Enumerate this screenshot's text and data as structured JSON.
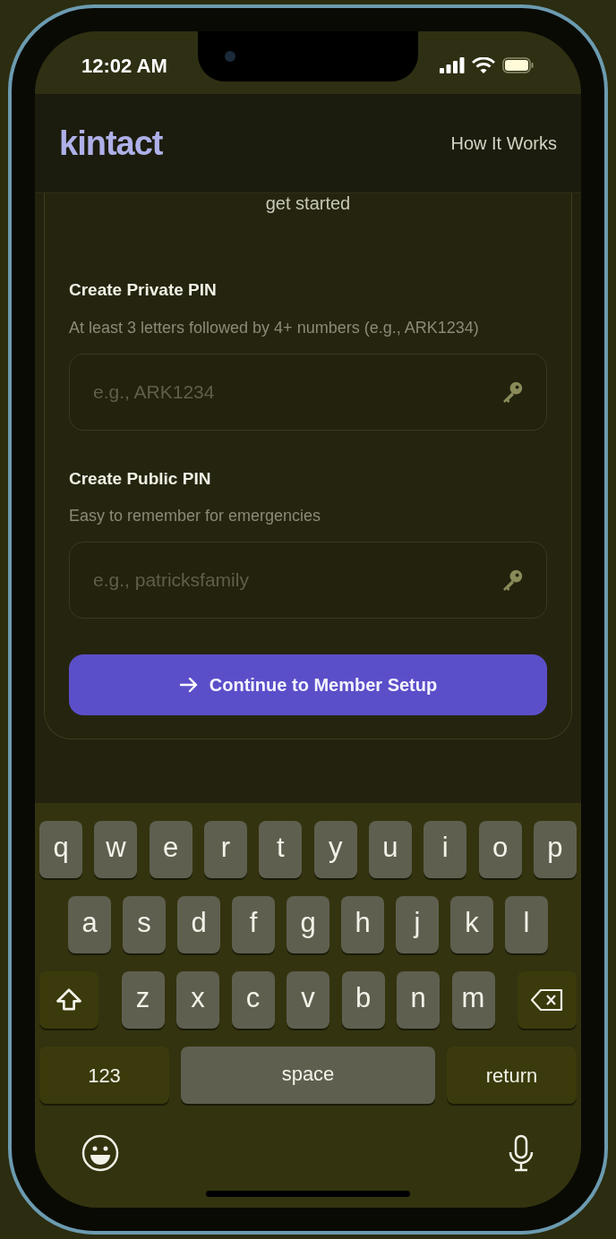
{
  "status_bar": {
    "time": "12:02 AM"
  },
  "header": {
    "logo": "kintact",
    "link": "How It Works"
  },
  "form": {
    "intro_text": "get started",
    "fields": [
      {
        "label": "Create Private PIN",
        "hint": "At least 3 letters followed by 4+ numbers (e.g., ARK1234)",
        "placeholder": "e.g., ARK1234"
      },
      {
        "label": "Create Public PIN",
        "hint": "Easy to remember for emergencies",
        "placeholder": "e.g., patricksfamily"
      }
    ],
    "button": "Continue to Member Setup"
  },
  "keyboard": {
    "rows": [
      {
        "keys": [
          {
            "kind": "letter",
            "text": "q"
          },
          {
            "kind": "letter",
            "text": "w"
          },
          {
            "kind": "letter",
            "text": "e"
          },
          {
            "kind": "letter",
            "text": "r"
          },
          {
            "kind": "letter",
            "text": "t"
          },
          {
            "kind": "letter",
            "text": "y"
          },
          {
            "kind": "letter",
            "text": "u"
          },
          {
            "kind": "letter",
            "text": "i"
          },
          {
            "kind": "letter",
            "text": "o"
          },
          {
            "kind": "letter",
            "text": "p"
          }
        ]
      },
      {
        "keys": [
          {
            "kind": "letter",
            "text": "a"
          },
          {
            "kind": "letter",
            "text": "s"
          },
          {
            "kind": "letter",
            "text": "d"
          },
          {
            "kind": "letter",
            "text": "f"
          },
          {
            "kind": "letter",
            "text": "g"
          },
          {
            "kind": "letter",
            "text": "h"
          },
          {
            "kind": "letter",
            "text": "j"
          },
          {
            "kind": "letter",
            "text": "k"
          },
          {
            "kind": "letter",
            "text": "l"
          }
        ]
      },
      {
        "keys": [
          {
            "kind": "shift"
          },
          {
            "kind": "letter",
            "text": "z"
          },
          {
            "kind": "letter",
            "text": "x"
          },
          {
            "kind": "letter",
            "text": "c"
          },
          {
            "kind": "letter",
            "text": "v"
          },
          {
            "kind": "letter",
            "text": "b"
          },
          {
            "kind": "letter",
            "text": "n"
          },
          {
            "kind": "letter",
            "text": "m"
          },
          {
            "kind": "delete"
          }
        ]
      },
      {
        "keys": [
          {
            "kind": "numbers",
            "text": "123"
          },
          {
            "kind": "space",
            "text": "space"
          },
          {
            "kind": "return",
            "text": "return"
          }
        ]
      }
    ]
  }
}
